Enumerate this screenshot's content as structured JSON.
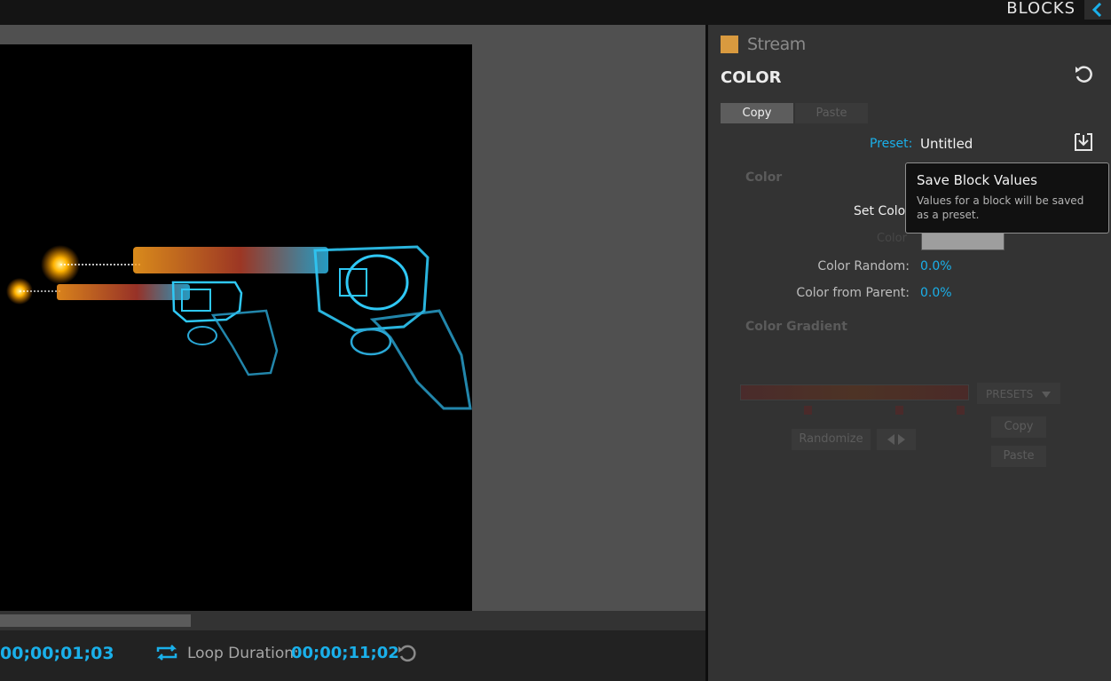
{
  "app": {
    "panel_title": "BLOCKS"
  },
  "timeline": {
    "timecode": "00;00;01;03",
    "loop_label": "Loop Duration:",
    "loop_value": "00;00;11;02",
    "scroll_position_fraction": 0.27
  },
  "block": {
    "name": "Stream",
    "swatch_color": "#d99a3f"
  },
  "section": {
    "title": "COLOR",
    "copy_label": "Copy",
    "paste_label": "Paste",
    "preset_label": "Preset:",
    "preset_value": "Untitled"
  },
  "color_group": {
    "title": "Color",
    "set_color_label": "Set Color",
    "color_label": "Color",
    "color_value": "#9e9e9e",
    "color_random_label": "Color Random:",
    "color_random_value": "0.0%",
    "color_from_parent_label": "Color from Parent:",
    "color_from_parent_value": "0.0%"
  },
  "gradient_group": {
    "title": "Color Gradient",
    "presets_label": "PRESETS",
    "randomize_label": "Randomize",
    "copy_label": "Copy",
    "paste_label": "Paste"
  },
  "tooltip": {
    "title": "Save Block Values",
    "body": "Values for a block will be saved as a preset."
  },
  "icons": {
    "collapse": "chevron-left-icon",
    "reset": "reset-icon",
    "save": "save-download-icon",
    "loop": "loop-icon",
    "reset_loop": "reset-loop-icon"
  },
  "colors": {
    "accent": "#1ab0ea",
    "panel_bg": "#333333",
    "viewer_bg": "#505050"
  }
}
